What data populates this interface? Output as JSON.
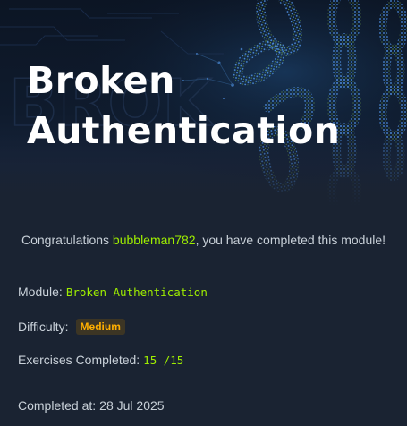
{
  "banner": {
    "title": "Broken Authentication",
    "watermark": "BROK"
  },
  "congrats": {
    "prefix": "Congratulations ",
    "username": "bubbleman782",
    "suffix": ", you have completed this module!"
  },
  "details": {
    "module_label": "Module:",
    "module_value": "Broken Authentication",
    "difficulty_label": "Difficulty:",
    "difficulty_value": "Medium",
    "exercises_label": "Exercises Completed:",
    "exercises_value": "15 /15",
    "completed_label": "Completed at:",
    "completed_value": "28 Jul 2025"
  },
  "colors": {
    "background": "#1a2332",
    "accent_green": "#9fef00",
    "badge_orange": "#ffaf00",
    "badge_bg": "#3c3524",
    "chain_blue": "#3a7bd5"
  }
}
